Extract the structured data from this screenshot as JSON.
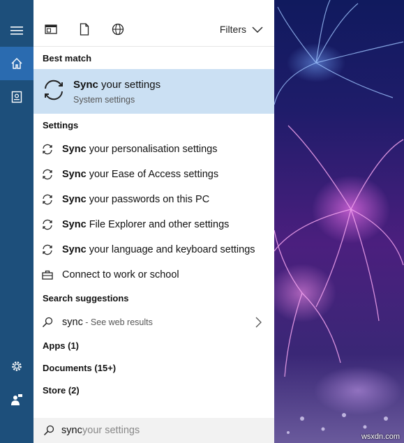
{
  "colors": {
    "rail": "#1d4f7b",
    "rail_active": "#2a6bb0",
    "highlight": "#cbe0f3"
  },
  "toolbar": {
    "filters_label": "Filters"
  },
  "best_match": {
    "heading": "Best match",
    "title_bold": "Sync",
    "title_rest": " your settings",
    "subtitle": "System settings"
  },
  "settings": {
    "heading": "Settings",
    "items": [
      {
        "bold": "Sync",
        "rest": " your personalisation settings",
        "icon": "sync-icon"
      },
      {
        "bold": "Sync",
        "rest": " your Ease of Access settings",
        "icon": "sync-icon"
      },
      {
        "bold": "Sync",
        "rest": " your passwords on this PC",
        "icon": "sync-icon"
      },
      {
        "bold": "Sync",
        "rest": " File Explorer and other settings",
        "icon": "sync-icon"
      },
      {
        "bold": "Sync",
        "rest": " your language and keyboard settings",
        "icon": "sync-icon"
      },
      {
        "bold": "",
        "rest": "Connect to work or school",
        "icon": "briefcase-icon"
      }
    ]
  },
  "suggestions": {
    "heading": "Search suggestions",
    "query": "sync",
    "suffix": " - See web results"
  },
  "counts": {
    "apps": "Apps (1)",
    "documents": "Documents (15+)",
    "store": "Store (2)"
  },
  "search": {
    "typed": "sync",
    "ghost": " your settings"
  },
  "watermark": "wsxdn.com"
}
